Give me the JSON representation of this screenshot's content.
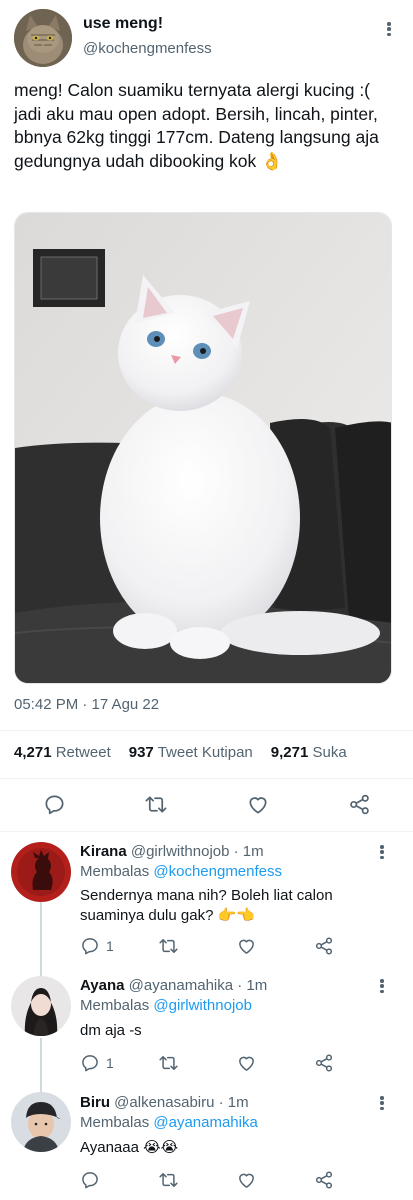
{
  "tweet": {
    "display_name": "use meng!",
    "handle": "@kochengmenfess",
    "text": "meng! Calon suamiku ternyata alergi kucing :( jadi aku mau open adopt. Bersih, lincah, pinter, bbnya 62kg tinggi 177cm. Dateng langsung aja gedungnya udah dibooking kok 👌",
    "timestamp": "05:42 PM · 17 Agu 22",
    "stats": {
      "retweets": "4,271",
      "retweets_label": "Retweet",
      "quotes": "937",
      "quotes_label": "Tweet Kutipan",
      "likes": "9,271",
      "likes_label": "Suka"
    }
  },
  "replies": [
    {
      "display_name": "Kirana",
      "handle": "@girlwithnojob",
      "time": "· 1m",
      "replying_prefix": "Membalas",
      "replying_to": "@kochengmenfess",
      "text": "Sendernya mana nih? Boleh liat calon suaminya dulu gak? 👉👈",
      "reply_count": "1"
    },
    {
      "display_name": "Ayana",
      "handle": "@ayanamahika",
      "time": "· 1m",
      "replying_prefix": "Membalas",
      "replying_to": "@girlwithnojob",
      "text": "dm aja -s",
      "reply_count": "1"
    },
    {
      "display_name": "Biru",
      "handle": "@alkenasabiru",
      "time": "· 1m",
      "replying_prefix": "Membalas",
      "replying_to": "@ayanamahika",
      "text": "Ayanaaa 😭😭",
      "reply_count": ""
    }
  ],
  "colors": {
    "accent": "#1d9bf0",
    "text": "#0f1419",
    "secondary": "#536471",
    "divider": "#eff3f4"
  },
  "icons": [
    "reply-icon",
    "retweet-icon",
    "like-icon",
    "share-icon",
    "more-icon"
  ]
}
